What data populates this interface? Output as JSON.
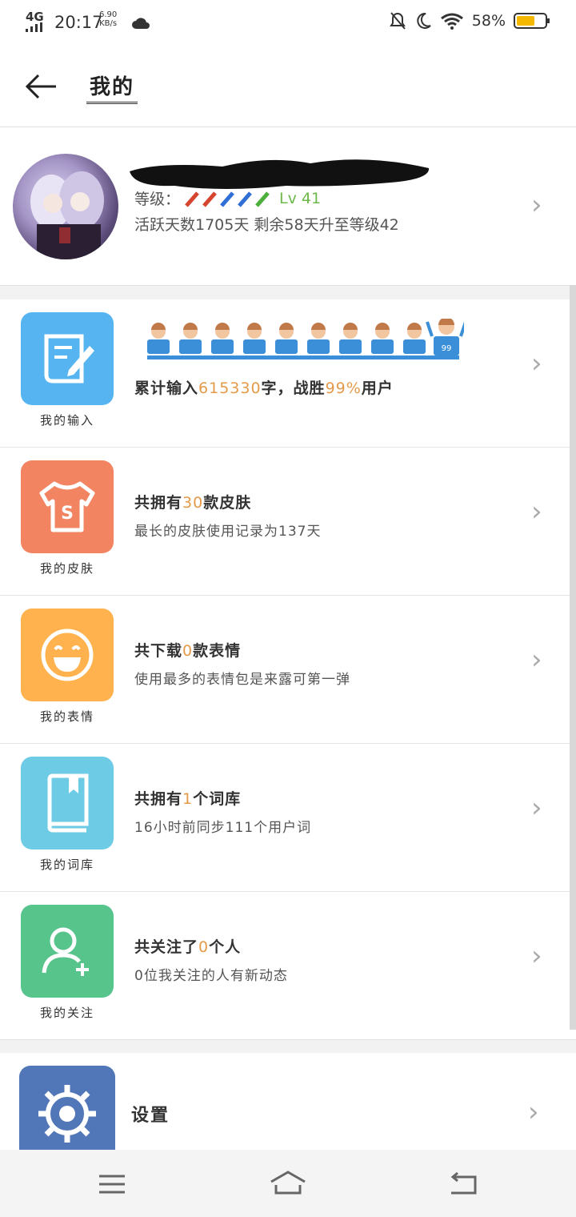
{
  "status_bar": {
    "network": "4G",
    "time": "20:17",
    "speed_value": "6.90",
    "speed_unit": "KB/s",
    "battery": "58%"
  },
  "header": {
    "title": "我的"
  },
  "profile": {
    "level_label": "等级：",
    "level_value": "Lv 41",
    "active_text": "活跃天数1705天 剩余58天升至等级42"
  },
  "rows": [
    {
      "icon": "scroll-pen-icon",
      "color": "#56b4f0",
      "label": "我的输入",
      "line1_prefix": "累计输入",
      "line1_highlight": "615330",
      "line1_mid": "字，战胜",
      "line1_highlight2": "99%",
      "line1_suffix": "用户",
      "rank_badge": "99"
    },
    {
      "icon": "tshirt-icon",
      "color": "#f28461",
      "label": "我的皮肤",
      "line1_prefix": "共拥有",
      "line1_highlight": "30",
      "line1_suffix": "款皮肤",
      "line2": "最长的皮肤使用记录为137天"
    },
    {
      "icon": "smiley-icon",
      "color": "#ffb24d",
      "label": "我的表情",
      "line1_prefix": "共下载",
      "line1_highlight": "0",
      "line1_suffix": "款表情",
      "line2": "使用最多的表情包是来露可第一弹"
    },
    {
      "icon": "book-icon",
      "color": "#6dcbe6",
      "label": "我的词库",
      "line1_prefix": "共拥有",
      "line1_highlight": "1",
      "line1_suffix": "个词库",
      "line2": "16小时前同步111个用户词"
    },
    {
      "icon": "add-user-icon",
      "color": "#57c48b",
      "label": "我的关注",
      "line1_prefix": "共关注了",
      "line1_highlight": "0",
      "line1_suffix": "个人",
      "line2": "0位我关注的人有新动态"
    }
  ],
  "settings": {
    "icon": "gear-icon",
    "label": "设置"
  },
  "nav": {
    "menu_icon": "menu-icon",
    "home_icon": "home-icon",
    "back_icon": "back-nav-icon"
  }
}
